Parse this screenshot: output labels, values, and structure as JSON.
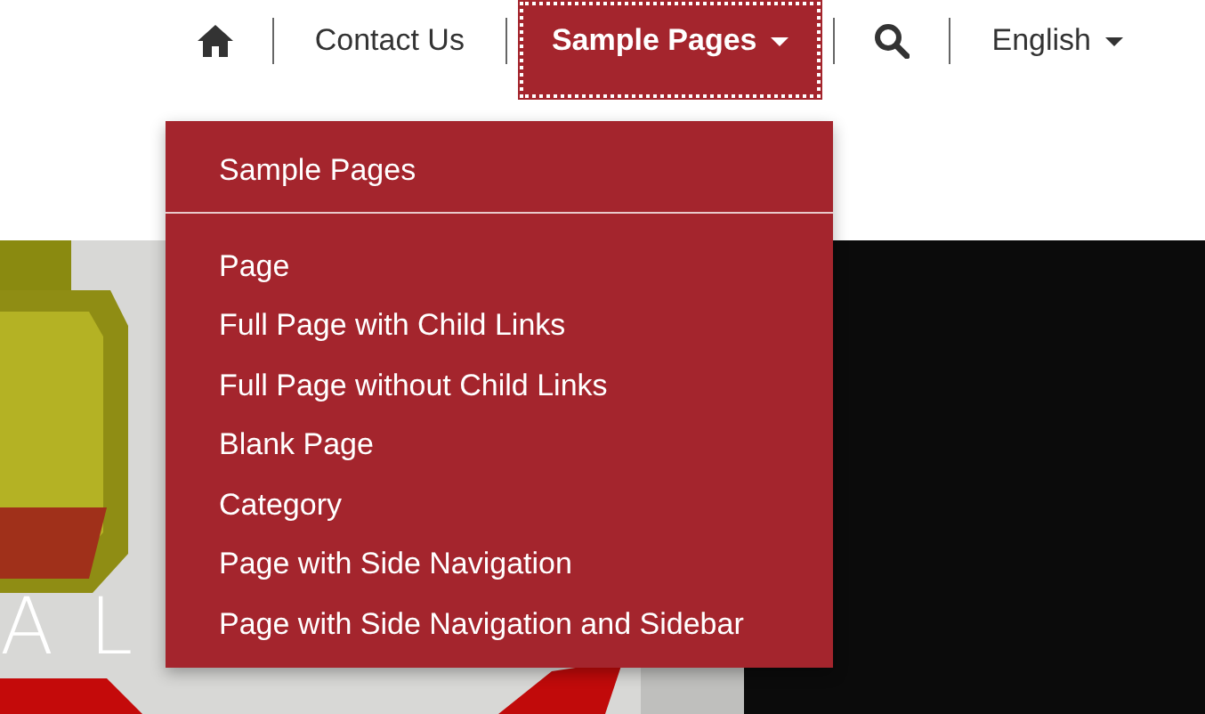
{
  "nav": [
    {
      "kind": "home",
      "selected": false
    },
    {
      "kind": "link",
      "label": "Contact Us",
      "selected": false
    },
    {
      "kind": "dropdown",
      "label": "Sample Pages",
      "selected": true
    },
    {
      "kind": "search",
      "selected": false
    },
    {
      "kind": "dropdown",
      "label": "English",
      "selected": false
    }
  ],
  "dropdown": {
    "header": "Sample Pages",
    "items": [
      "Page",
      "Full Page with Child Links",
      "Full Page without Child Links",
      "Blank Page",
      "Category",
      "Page with Side Navigation",
      "Page with Side Navigation and Sidebar"
    ]
  },
  "hero": {
    "kind": "picture",
    "caption": "A L"
  }
}
